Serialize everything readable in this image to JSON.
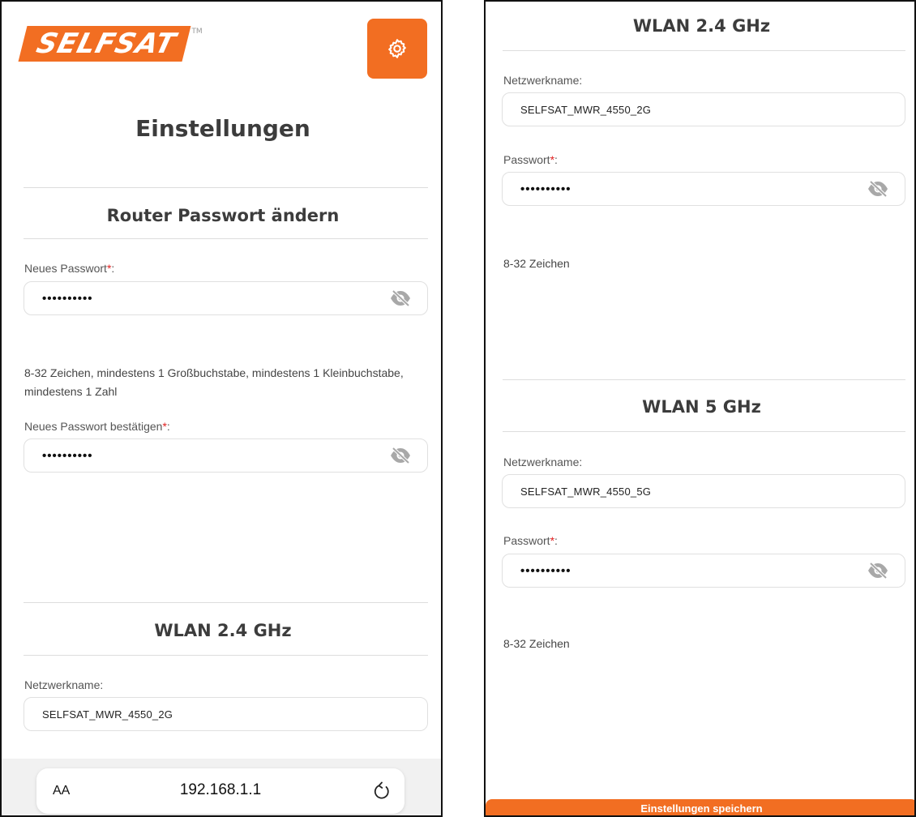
{
  "brand": {
    "name": "SELFSAT",
    "tm": "TM",
    "accent": "#f26e22"
  },
  "left": {
    "page_title": "Einstellungen",
    "router_section": {
      "title": "Router Passwort ändern",
      "new_password_label": "Neues Passwort",
      "new_password_value": "••••••••••",
      "hint": "8-32 Zeichen, mindestens 1 Großbuchstabe, mindestens 1 Kleinbuchstabe, mindestens 1 Zahl",
      "confirm_label": "Neues Passwort bestätigen",
      "confirm_value": "••••••••••"
    },
    "wlan24_section": {
      "title": "WLAN 2.4 GHz",
      "network_label": "Netzwerkname:",
      "network_value": "SELFSAT_MWR_4550_2G"
    },
    "browser": {
      "text_size": "AA",
      "url": "192.168.1.1"
    }
  },
  "right": {
    "wlan24_section": {
      "title": "WLAN 2.4 GHz",
      "network_label": "Netzwerkname:",
      "network_value": "SELFSAT_MWR_4550_2G",
      "password_label": "Passwort",
      "password_value": "••••••••••",
      "hint": "8-32 Zeichen"
    },
    "wlan5_section": {
      "title": "WLAN 5 GHz",
      "network_label": "Netzwerkname:",
      "network_value": "SELFSAT_MWR_4550_5G",
      "password_label": "Passwort",
      "password_value": "••••••••••",
      "hint": "8-32 Zeichen"
    },
    "save_button": "Einstellungen speichern"
  },
  "common": {
    "required_marker": "*",
    "label_colon": ":"
  },
  "icons": {
    "settings": "gear-icon",
    "password_visibility": "eye-slash-icon",
    "reload": "reload-icon"
  }
}
